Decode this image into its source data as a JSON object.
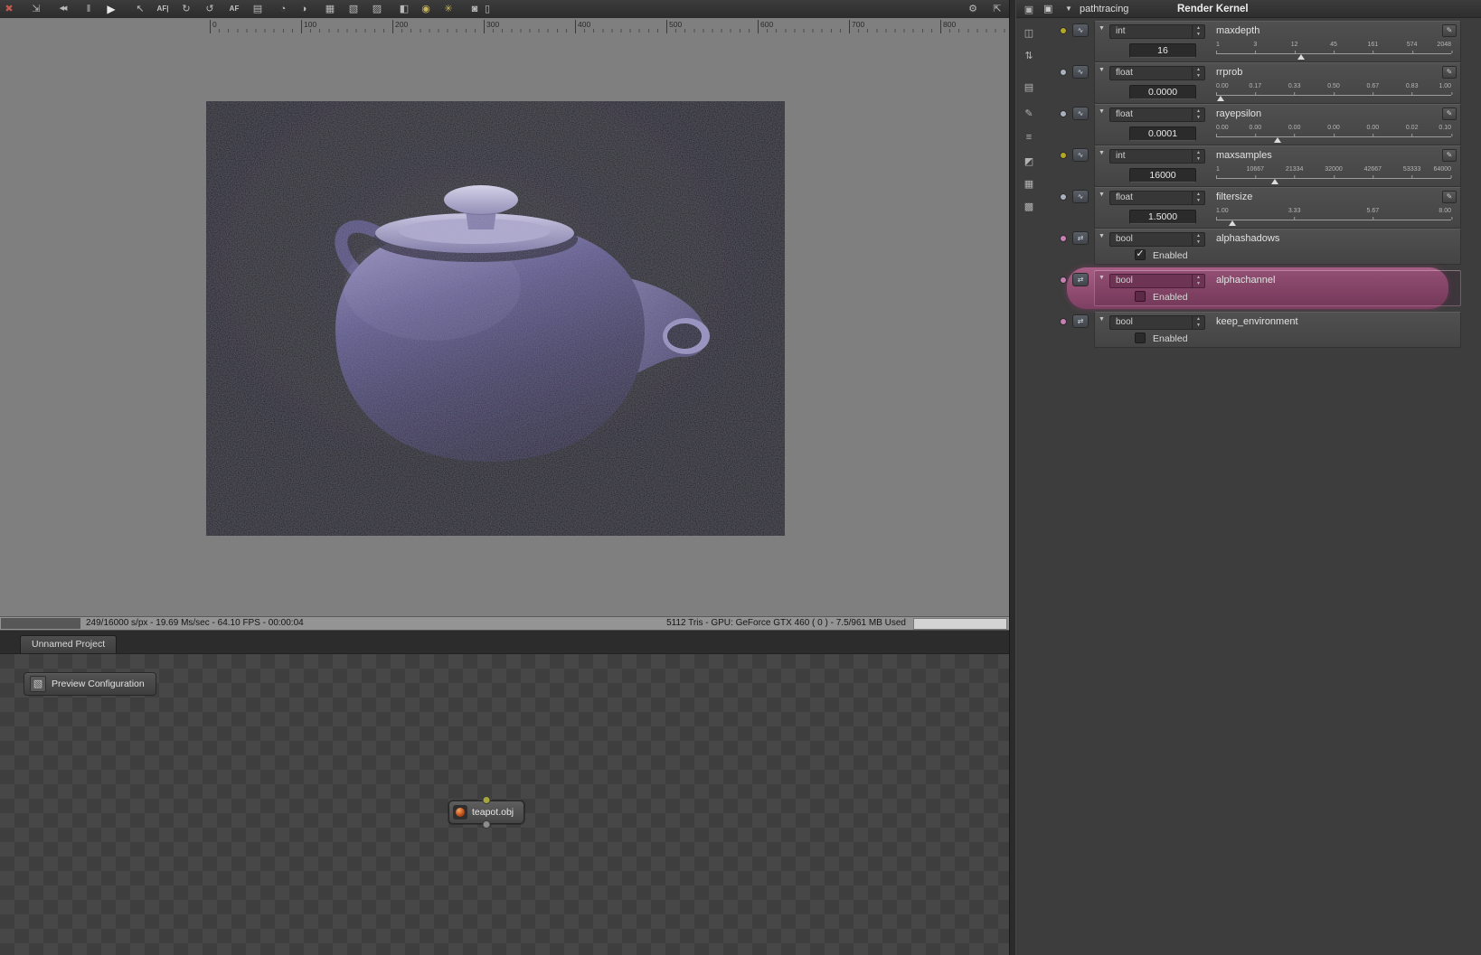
{
  "colors": {
    "viewport_bg": "#7f7f7f",
    "panel_bg": "#3d3d3d",
    "highlight_row": "#96507a",
    "dot_int": "#b3a723",
    "dot_float": "#abb0bf",
    "dot_bool": "#c77fb4",
    "node_port_in": "#a6a63c",
    "teapot_body": "#5b5589"
  },
  "ui": {
    "collapse_glyph": "▼",
    "spin_up": "▲",
    "spin_down": "▼",
    "curve_glyph": "✎",
    "preview_icon_glyph": "▧"
  },
  "toolbar": {
    "icons": [
      {
        "name": "stop-render",
        "glyph": "✖"
      },
      {
        "name": "reset-view",
        "glyph": "⇲"
      },
      {
        "name": "restart-render",
        "glyph": "◀◀"
      },
      {
        "name": "pause-render",
        "glyph": "‖"
      },
      {
        "name": "play-render",
        "glyph": "▶"
      },
      {
        "name": "pick-material",
        "glyph": "↖"
      },
      {
        "name": "autofocus",
        "glyph": "AF|"
      },
      {
        "name": "refresh-render",
        "glyph": "↻"
      },
      {
        "name": "white-balance-picker",
        "glyph": "↺"
      },
      {
        "name": "autofocus-lock",
        "glyph": "AF"
      },
      {
        "name": "print",
        "glyph": "▤"
      },
      {
        "name": "orbit-camera",
        "glyph": "◔"
      },
      {
        "name": "turntable",
        "glyph": "◑"
      },
      {
        "name": "checker-alpha",
        "glyph": "▦"
      },
      {
        "name": "checker-background",
        "glyph": "▧"
      },
      {
        "name": "checker-grid",
        "glyph": "▨"
      },
      {
        "name": "region-render",
        "glyph": "◧"
      },
      {
        "name": "subsample",
        "glyph": "◉"
      },
      {
        "name": "markers",
        "glyph": "✳"
      },
      {
        "name": "lock-resolution",
        "glyph": "◙"
      },
      {
        "name": "copy-frame",
        "glyph": "▯"
      },
      {
        "name": "settings",
        "glyph": "⚙"
      },
      {
        "name": "fullscreen",
        "glyph": "⇱"
      }
    ]
  },
  "viewport": {
    "ruler_labels": [
      "0",
      "100",
      "200",
      "300",
      "400",
      "500",
      "600",
      "700",
      "800"
    ],
    "status_left": "249/16000 s/px - 19.69 Ms/sec - 64.10 FPS - 00:00:04",
    "status_right": "5112 Tris - GPU: GeForce GTX 460 ( 0 ) - 7.5/961 MB Used"
  },
  "side_strip": [
    {
      "name": "render-target",
      "glyph": "▣"
    },
    {
      "name": "copy-image",
      "glyph": "◫"
    },
    {
      "name": "compare",
      "glyph": "⇅"
    },
    {
      "name": "render-passes",
      "glyph": "▤"
    },
    {
      "name": "camera-edit",
      "glyph": "✎"
    },
    {
      "name": "imager",
      "glyph": "≡"
    },
    {
      "name": "save-image",
      "glyph": "◩"
    },
    {
      "name": "image-view",
      "glyph": "▦"
    },
    {
      "name": "alpha-background",
      "glyph": "▩"
    }
  ],
  "inspector": {
    "header_icon_glyph": "▣",
    "node_name": "pathtracing",
    "node_type": "Render Kernel",
    "params": [
      {
        "kind": "int",
        "type_label": "int",
        "icon_glyph": "∿",
        "name": "maxdepth",
        "value": "16",
        "ticks": [
          "1",
          "3",
          "12",
          "45",
          "161",
          "574",
          "2048"
        ],
        "marker_style": "left:36%"
      },
      {
        "kind": "float",
        "type_label": "float",
        "icon_glyph": "∿",
        "name": "rrprob",
        "value": "0.0000",
        "ticks": [
          "0.00",
          "0.17",
          "0.33",
          "0.50",
          "0.67",
          "0.83",
          "1.00"
        ],
        "marker_style": "left:2%"
      },
      {
        "kind": "float",
        "type_label": "float",
        "icon_glyph": "∿",
        "name": "rayepsilon",
        "value": "0.0001",
        "ticks": [
          "0.00",
          "0.00",
          "0.00",
          "0.00",
          "0.00",
          "0.02",
          "0.10"
        ],
        "marker_style": "left:26%"
      },
      {
        "kind": "int",
        "type_label": "int",
        "icon_glyph": "∿",
        "name": "maxsamples",
        "value": "16000",
        "ticks": [
          "1",
          "10667",
          "21334",
          "32000",
          "42667",
          "53333",
          "64000"
        ],
        "marker_style": "left:25%"
      },
      {
        "kind": "float",
        "type_label": "float",
        "icon_glyph": "∿",
        "name": "filtersize",
        "value": "1.5000",
        "ticks": [
          "1.00",
          "3.33",
          "5.67",
          "8.00"
        ],
        "marker_style": "left:7%"
      },
      {
        "kind": "bool",
        "type_label": "bool",
        "icon_glyph": "⇄",
        "name": "alphashadows",
        "check": "✓",
        "enabled_label": "Enabled"
      },
      {
        "kind": "bool",
        "type_label": "bool",
        "icon_glyph": "⇄",
        "name": "alphachannel",
        "check": "",
        "enabled_label": "Enabled",
        "highlighted": true
      },
      {
        "kind": "bool",
        "type_label": "bool",
        "icon_glyph": "⇄",
        "name": "keep_environment",
        "check": "",
        "enabled_label": "Enabled"
      }
    ]
  },
  "project": {
    "tab": "Unnamed Project",
    "preview_button": "Preview Configuration",
    "node_label": "teapot.obj"
  }
}
